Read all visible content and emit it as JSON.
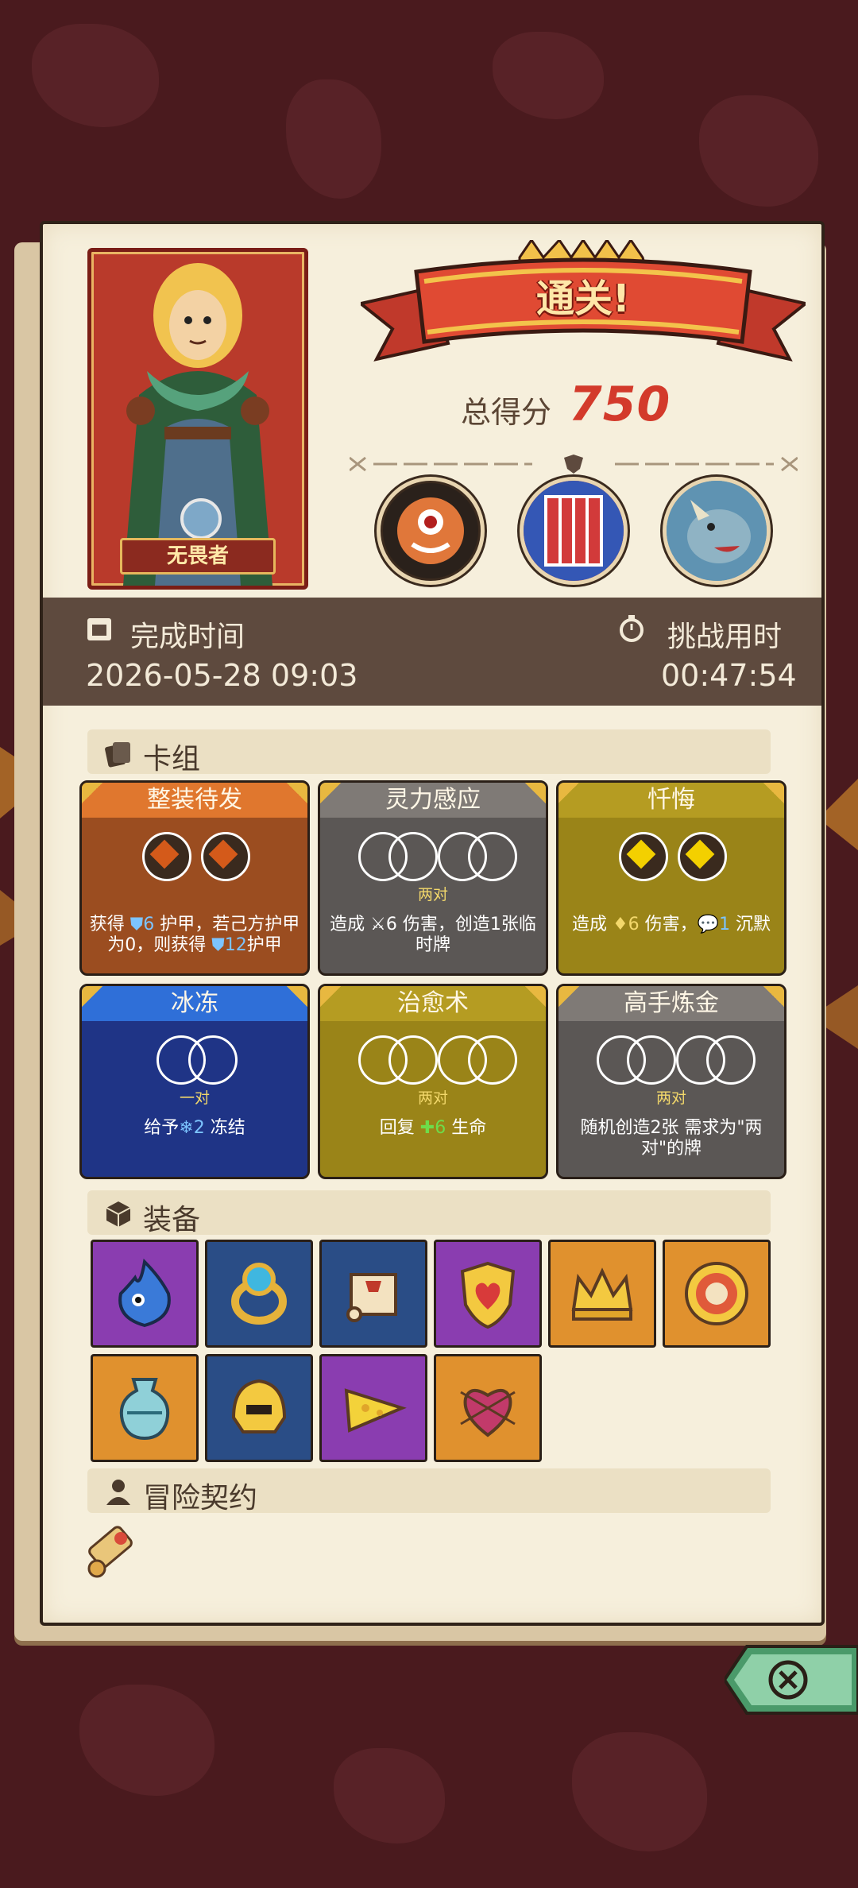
{
  "hero": {
    "name": "无畏者"
  },
  "result": {
    "banner": "通关!",
    "score_label": "总得分",
    "score_value": "750"
  },
  "bosses": [
    {
      "icon": "cyclops-boss-icon"
    },
    {
      "icon": "caged-demon-boss-icon"
    },
    {
      "icon": "rhino-beast-boss-icon"
    }
  ],
  "times": {
    "finish_label": "完成时间",
    "finish_value": "2026-05-28 09:03",
    "duration_label": "挑战用时",
    "duration_value": "00:47:54"
  },
  "deck": {
    "title": "卡组",
    "cards": [
      {
        "name": "整装待发",
        "theme": "#9b4d20",
        "header": "#e0772e",
        "sub": "",
        "desc": [
          "获得 ",
          {
            "c": "blue",
            "t": "⛊6"
          },
          " 护甲，若己方护甲为0，则获得 ",
          {
            "c": "blue",
            "t": "⛊12"
          },
          "护甲"
        ]
      },
      {
        "name": "灵力感应",
        "theme": "#5b5755",
        "header": "#7f7a76",
        "sub": "两对",
        "desc": [
          "造成 ",
          {
            "c": "",
            "t": "⚔6"
          },
          " 伤害，创造1张临时牌"
        ]
      },
      {
        "name": "忏悔",
        "theme": "#9a8418",
        "header": "#b59c22",
        "sub": "",
        "desc": [
          "造成 ",
          {
            "c": "gold",
            "t": "♦6"
          },
          " 伤害，",
          {
            "c": "blue",
            "t": "💬1"
          },
          " 沉默"
        ]
      },
      {
        "name": "冰冻",
        "theme": "#1f3486",
        "header": "#2f6fd8",
        "sub": "一对",
        "desc": [
          "给予",
          {
            "c": "blue",
            "t": "❄2"
          },
          " 冻结"
        ]
      },
      {
        "name": "治愈术",
        "theme": "#9a8418",
        "header": "#b59c22",
        "sub": "两对",
        "desc": [
          "回复 ",
          {
            "c": "green",
            "t": "✚6"
          },
          " 生命"
        ]
      },
      {
        "name": "高手炼金",
        "theme": "#5b5755",
        "header": "#7f7a76",
        "sub": "两对",
        "desc": [
          "随机创造2张 需求为\"两对\"的牌"
        ]
      }
    ]
  },
  "equipment": {
    "title": "装备",
    "items": [
      {
        "icon": "blue-flame-spirit-icon",
        "bg": "#8a3db0"
      },
      {
        "icon": "gold-ring-icon",
        "bg": "#2a4d86"
      },
      {
        "icon": "scroll-icon",
        "bg": "#2a4d86"
      },
      {
        "icon": "heart-shield-icon",
        "bg": "#8a3db0"
      },
      {
        "icon": "crown-icon",
        "bg": "#e0912e"
      },
      {
        "icon": "round-shield-icon",
        "bg": "#e0912e"
      },
      {
        "icon": "vase-icon",
        "bg": "#e0912e"
      },
      {
        "icon": "golden-helmet-icon",
        "bg": "#2a4d86"
      },
      {
        "icon": "cheese-wedge-icon",
        "bg": "#8a3db0"
      },
      {
        "icon": "thorn-heart-icon",
        "bg": "#e0912e"
      }
    ]
  },
  "contract": {
    "title": "冒险契约",
    "icon": "contract-scroll-icon"
  },
  "close": {
    "icon": "close-icon"
  }
}
